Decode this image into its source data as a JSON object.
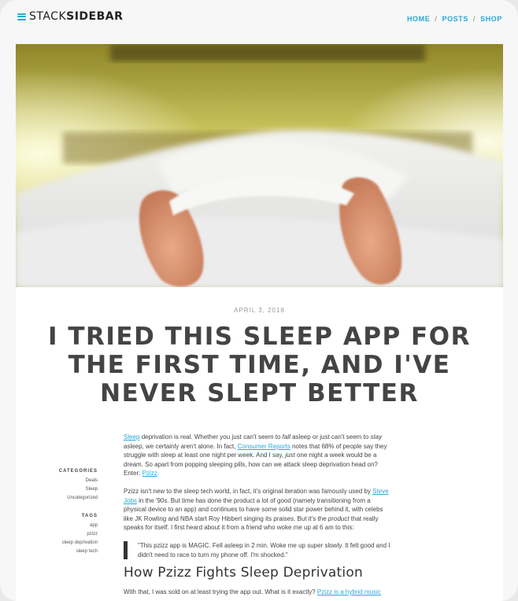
{
  "header": {
    "logo_light": "STACK",
    "logo_bold": "SIDEBAR",
    "nav": [
      "HOME",
      "POSTS",
      "SHOP"
    ],
    "nav_separator": "/"
  },
  "hero": {
    "image": "feet-under-white-bedsheets-photo"
  },
  "post": {
    "date": "APRIL 3, 2018",
    "title": "I TRIED THIS SLEEP APP FOR THE FIRST TIME, AND I'VE NEVER SLEPT BETTER",
    "p1": {
      "link1": "Sleep",
      "t1": " deprivation is real. Whether you just can't seem to ",
      "em1": "fall",
      "t2": " asleep or just can't seem to ",
      "em2": "stay",
      "t3": " asleep, we certainly aren't alone. In fact, ",
      "link2": "Consumer Reports",
      "t4": " notes that 68% of people say they struggle with sleep at least one night per week. And I say, ",
      "em3": "just",
      "t5": " one night a week would be a dream. So apart from popping sleeping pills, how can we attack sleep deprivation head on? Enter: ",
      "link3": "Pzizz",
      "t6": "."
    },
    "p2": {
      "t1": "Pzizz isn't new to the sleep tech world, in fact, it's original iteration was famously used by ",
      "link1": "Steve Jobs",
      "t2": " in the '90s. But time has done the product a lot of good (namely transitioning from a physical device to an app) and continues to have some solid star power behind it, with celebs like JK Rowling and NBA start Roy Hibbert singing its praises. But it's the ",
      "em1": "product",
      "t3": " that really speaks for itself. I first heard about it from a friend who woke me up at 6 am to this:"
    },
    "quote": "\"This pzizz app is MAGIC. Fell asleep in 2 min. Woke me up super slowly. It felt good and I didn't need to race to turn my phone off. I'm shocked.\"",
    "heading": "How Pzizz Fights Sleep Deprivation",
    "p3": {
      "t1": "With that, I was sold on at least trying the app out. What is it exactly? ",
      "link1": "Pzizz is a hybrid music"
    }
  },
  "sidebar": {
    "categories_heading": "CATEGORIES",
    "categories": [
      "Deals",
      "Sleep",
      "Uncategorized"
    ],
    "tags_heading": "TAGS",
    "tags": [
      "app",
      "pzizz",
      "sleep deprivation",
      "sleep tech"
    ]
  },
  "colors": {
    "accent": "#27a8d9",
    "text": "#444444",
    "background": "#f7f7f7"
  }
}
